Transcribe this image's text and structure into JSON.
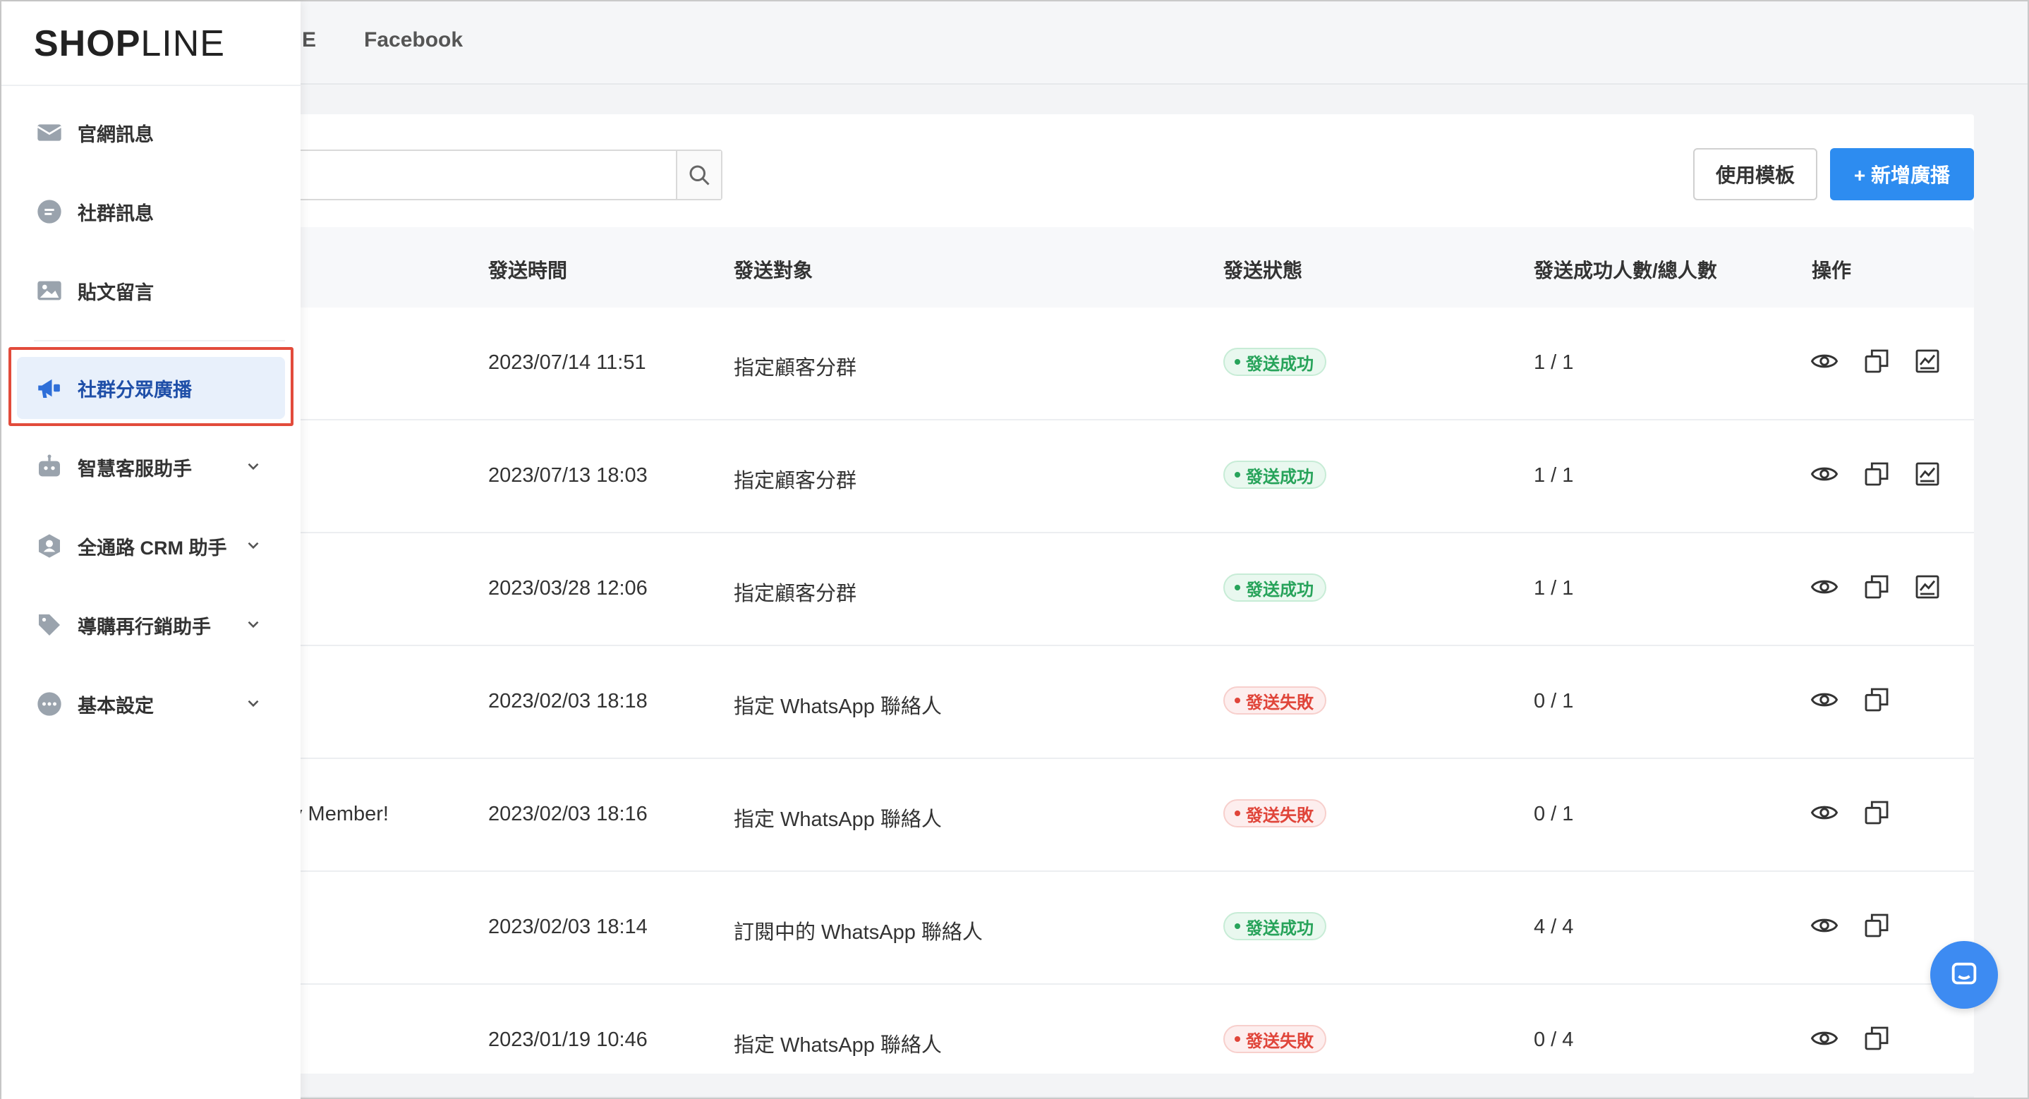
{
  "brand": {
    "logo_bold": "SH",
    "logo_o": "O",
    "logo_p": "P",
    "logo_light": "LINE"
  },
  "top_tabs": [
    "E",
    "Facebook"
  ],
  "toolbar": {
    "template_label": "使用模板",
    "new_label": "+ 新增廣播",
    "search_placeholder": ""
  },
  "sidebar": {
    "items": [
      {
        "label": "官網訊息",
        "icon": "mail-icon"
      },
      {
        "label": "社群訊息",
        "icon": "chat-icon"
      },
      {
        "label": "貼文留言",
        "icon": "image-icon"
      },
      {
        "label": "社群分眾廣播",
        "icon": "megaphone-icon",
        "active": true
      },
      {
        "label": "智慧客服助手",
        "icon": "robot-icon",
        "expandable": true
      },
      {
        "label": "全通路 CRM 助手",
        "icon": "crm-icon",
        "expandable": true
      },
      {
        "label": "導購再行銷助手",
        "icon": "tag-icon",
        "expandable": true
      },
      {
        "label": "基本設定",
        "icon": "more-icon",
        "expandable": true
      }
    ]
  },
  "table": {
    "headers": [
      "發送時間",
      "發送對象",
      "發送狀態",
      "發送成功人數/總人數",
      "操作"
    ],
    "rows": [
      {
        "name": "",
        "time": "2023/07/14 11:51",
        "target": "指定顧客分群",
        "status": "發送成功",
        "status_type": "success",
        "count": "1 / 1",
        "has_chart": true
      },
      {
        "name": "",
        "time": "2023/07/13 18:03",
        "target": "指定顧客分群",
        "status": "發送成功",
        "status_type": "success",
        "count": "1 / 1",
        "has_chart": true
      },
      {
        "name": "",
        "time": "2023/03/28 12:06",
        "target": "指定顧客分群",
        "status": "發送成功",
        "status_type": "success",
        "count": "1 / 1",
        "has_chart": true
      },
      {
        "name": "!",
        "time": "2023/02/03 18:18",
        "target": "指定 WhatsApp 聯絡人",
        "status": "發送失敗",
        "status_type": "fail",
        "count": "0 / 1",
        "has_chart": false
      },
      {
        "name": "v Member!",
        "time": "2023/02/03 18:16",
        "target": "指定 WhatsApp 聯絡人",
        "status": "發送失敗",
        "status_type": "fail",
        "count": "0 / 1",
        "has_chart": false
      },
      {
        "name": "",
        "time": "2023/02/03 18:14",
        "target": "訂閱中的 WhatsApp 聯絡人",
        "status": "發送成功",
        "status_type": "success",
        "count": "4 / 4",
        "has_chart": false
      },
      {
        "name": "",
        "time": "2023/01/19 10:46",
        "target": "指定 WhatsApp 聯絡人",
        "status": "發送失敗",
        "status_type": "fail",
        "count": "0 / 4",
        "has_chart": false
      }
    ]
  },
  "colors": {
    "accent": "#2d8cf0",
    "success": "#27a35a",
    "fail": "#e0453a",
    "highlight": "#e24b3b"
  }
}
